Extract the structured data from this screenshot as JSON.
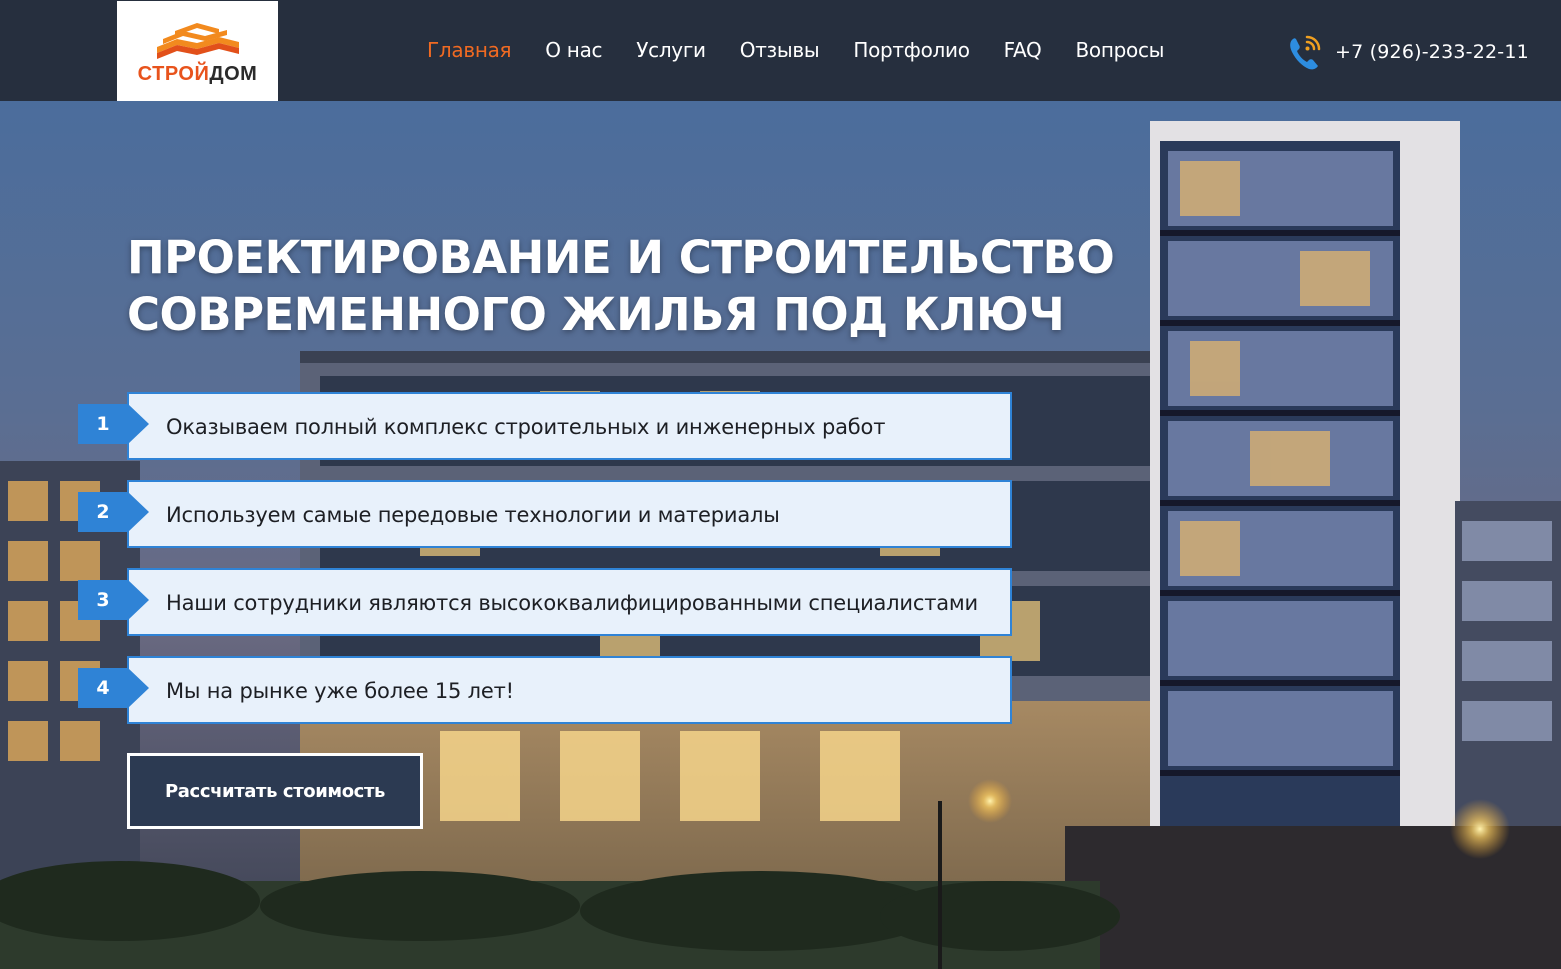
{
  "brand": {
    "logo_part1": "СТРОЙ",
    "logo_part2": "ДОМ",
    "accent_color": "#f06a22",
    "logo_color": "#e8531c"
  },
  "nav": {
    "items": [
      {
        "label": "Главная",
        "active": true
      },
      {
        "label": "О нас"
      },
      {
        "label": "Услуги"
      },
      {
        "label": "Отзывы"
      },
      {
        "label": "Портфолио"
      },
      {
        "label": "FAQ"
      },
      {
        "label": "Вопросы"
      }
    ]
  },
  "contact": {
    "phone_icon": "phone-signal-icon",
    "phone": "+7 (926)-233-22-11"
  },
  "hero": {
    "title_line1": "ПРОЕКТИРОВАНИЕ И СТРОИТЕЛЬСТВО",
    "title_line2": "СОВРЕМЕННОГО ЖИЛЬЯ ПОД КЛЮЧ",
    "features": [
      {
        "num": "1",
        "text": "Оказываем полный комплекс строительных и инженерных работ"
      },
      {
        "num": "2",
        "text": "Используем самые передовые технологии и материалы"
      },
      {
        "num": "3",
        "text": "Наши сотрудники являются высококвалифицированными специалистами"
      },
      {
        "num": "4",
        "text": "Мы на рынке уже более 15 лет!"
      }
    ],
    "cta_label": "Рассчитать стоимость",
    "badge_color": "#2f83d6"
  }
}
